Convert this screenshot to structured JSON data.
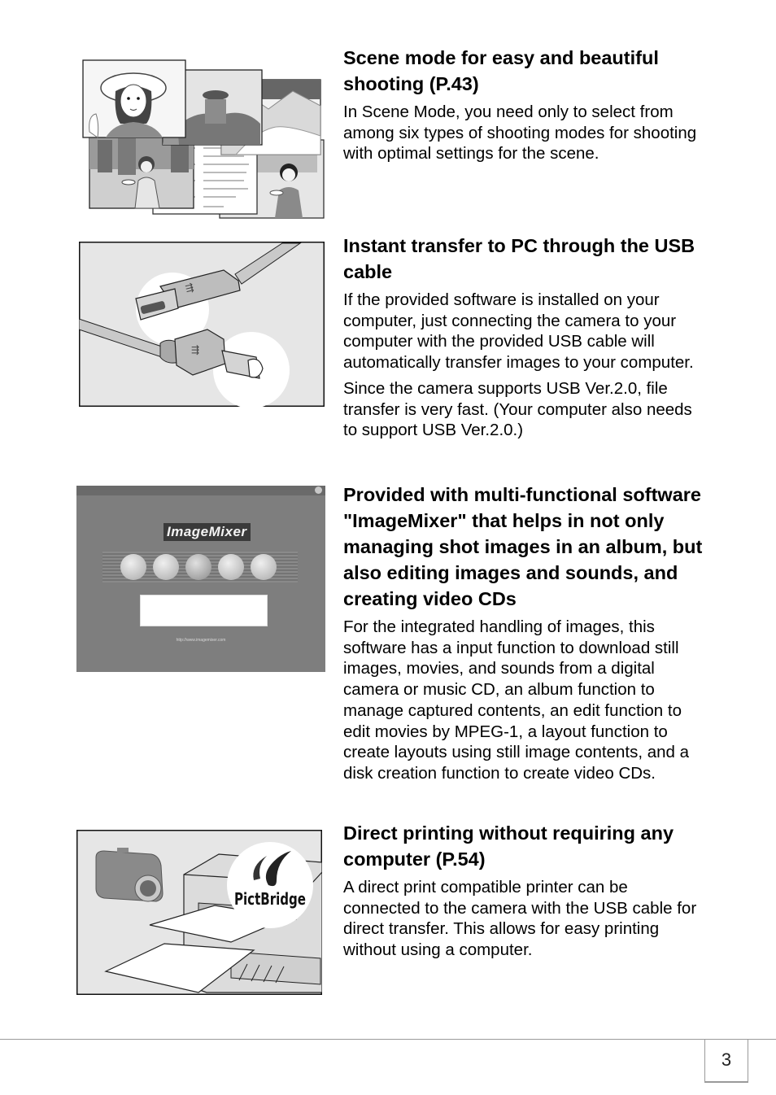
{
  "sections": [
    {
      "heading": "Scene mode for easy and beautiful shooting (P.43)",
      "paragraphs": [
        "In Scene Mode, you need only to select from among six types of shooting modes for shooting with optimal settings for the scene."
      ],
      "figure": "scene-mode-illustration"
    },
    {
      "heading": "Instant transfer to PC through the USB cable",
      "paragraphs": [
        "If the provided software is installed on your computer, just connecting the camera to your computer with the provided USB cable will automatically transfer images to your computer.",
        "Since the camera supports USB Ver.2.0, file transfer is very fast. (Your computer also needs to support USB Ver.2.0.)"
      ],
      "figure": "usb-cable-illustration"
    },
    {
      "heading": "Provided with multi-functional software \"ImageMixer\" that helps in not only managing shot images in an album, but also editing images and sounds, and creating video CDs",
      "paragraphs": [
        "For the integrated handling of images, this software has a input function to download still images, movies, and sounds from a digital camera or music CD, an album function to manage captured contents, an edit function to edit movies by MPEG-1, a layout function to create layouts using still image contents, and a disk creation function to create video CDs."
      ],
      "figure": "imagemixer-screenshot",
      "figure_text": {
        "logo": "ImageMixer",
        "url": "http://www.imagemixer.com"
      }
    },
    {
      "heading": "Direct printing without requiring any computer (P.54)",
      "paragraphs": [
        "A direct print compatible printer can be connected to the camera with the USB cable for direct transfer. This allows for easy printing without using a computer."
      ],
      "figure": "pictbridge-illustration",
      "figure_text": {
        "logo": "PictBridge"
      }
    }
  ],
  "footer": {
    "page_number": "3"
  }
}
